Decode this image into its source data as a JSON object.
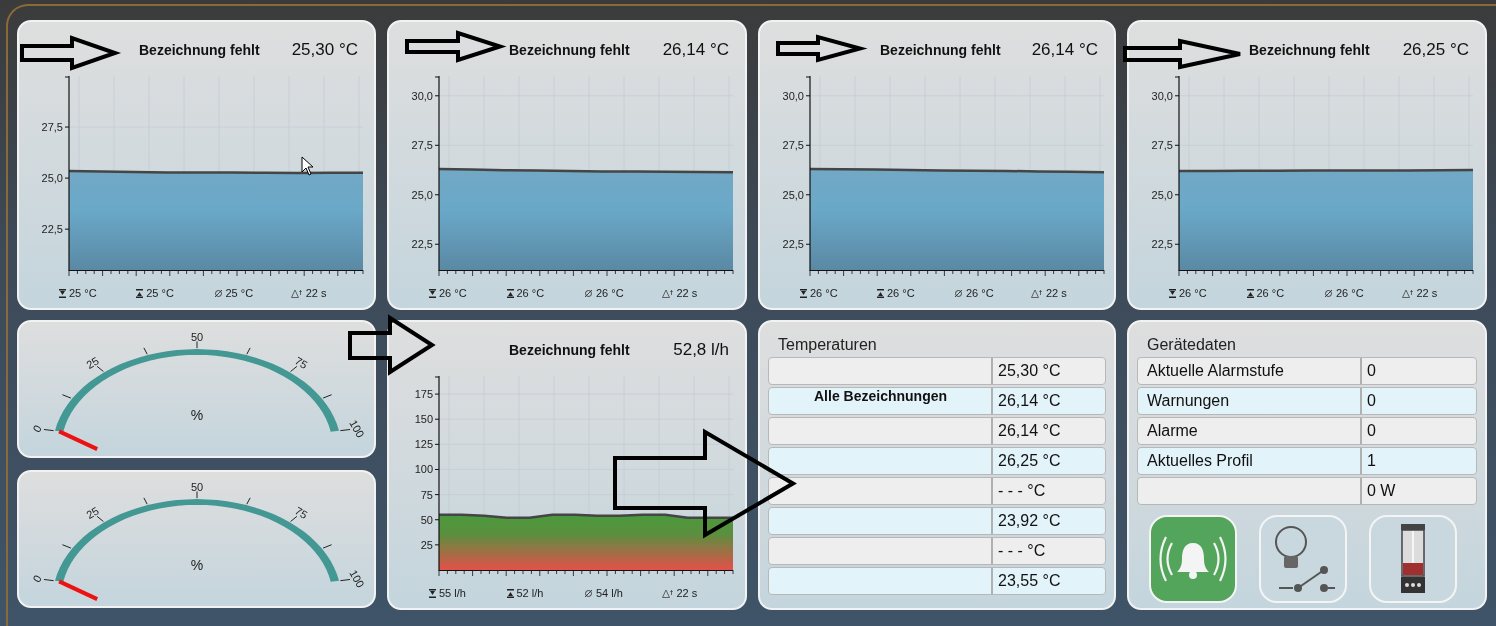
{
  "top_row": [
    {
      "title": "Bezeichnung fehlt",
      "reading": "25,30 °C",
      "chart_data": {
        "type": "area",
        "grid": true,
        "values": [
          25.35,
          25.33,
          25.3,
          25.28,
          25.27,
          25.27,
          25.26,
          25.25,
          25.26,
          25.26
        ],
        "ylim": [
          20.5,
          30
        ],
        "yticks": [
          {
            "value": 22.5,
            "label": "22,5"
          },
          {
            "value": 25,
            "label": "25,0"
          },
          {
            "value": 27.5,
            "label": "27,5"
          }
        ]
      },
      "stats": [
        {
          "kind": "max",
          "value": "25 °C"
        },
        {
          "kind": "min",
          "value": "25 °C"
        },
        {
          "kind": "average",
          "value": "25 °C"
        },
        {
          "kind": "span",
          "value": "22 s"
        }
      ]
    },
    {
      "title": "Bezeichnung fehlt",
      "reading": "26,14 °C",
      "chart_data": {
        "type": "area",
        "grid": true,
        "values": [
          26.3,
          26.28,
          26.24,
          26.22,
          26.2,
          26.18,
          26.17,
          26.16,
          26.15,
          26.14
        ],
        "ylim": [
          21.2,
          31
        ],
        "yticks": [
          {
            "value": 22.5,
            "label": "22,5"
          },
          {
            "value": 25,
            "label": "25,0"
          },
          {
            "value": 27.5,
            "label": "27,5"
          },
          {
            "value": 30,
            "label": "30,0"
          }
        ]
      },
      "stats": [
        {
          "kind": "max",
          "value": "26 °C"
        },
        {
          "kind": "min",
          "value": "26 °C"
        },
        {
          "kind": "average",
          "value": "26 °C"
        },
        {
          "kind": "span",
          "value": "22 s"
        }
      ]
    },
    {
      "title": "Bezeichnung fehlt",
      "reading": "26,14 °C",
      "chart_data": {
        "type": "area",
        "grid": true,
        "values": [
          26.3,
          26.29,
          26.27,
          26.25,
          26.23,
          26.21,
          26.2,
          26.18,
          26.16,
          26.14
        ],
        "ylim": [
          21.2,
          31
        ],
        "yticks": [
          {
            "value": 22.5,
            "label": "22,5"
          },
          {
            "value": 25,
            "label": "25,0"
          },
          {
            "value": 27.5,
            "label": "27,5"
          },
          {
            "value": 30,
            "label": "30,0"
          }
        ]
      },
      "stats": [
        {
          "kind": "max",
          "value": "26 °C"
        },
        {
          "kind": "min",
          "value": "26 °C"
        },
        {
          "kind": "average",
          "value": "26 °C"
        },
        {
          "kind": "span",
          "value": "22 s"
        }
      ]
    },
    {
      "title": "Bezeichnung fehlt",
      "reading": "26,25 °C",
      "chart_data": {
        "type": "area",
        "grid": true,
        "values": [
          26.2,
          26.2,
          26.21,
          26.21,
          26.22,
          26.22,
          26.23,
          26.23,
          26.24,
          26.25
        ],
        "ylim": [
          21.2,
          31
        ],
        "yticks": [
          {
            "value": 22.5,
            "label": "22,5"
          },
          {
            "value": 25,
            "label": "25,0"
          },
          {
            "value": 27.5,
            "label": "27,5"
          },
          {
            "value": 30,
            "label": "30,0"
          }
        ]
      },
      "stats": [
        {
          "kind": "max",
          "value": "26 °C"
        },
        {
          "kind": "min",
          "value": "26 °C"
        },
        {
          "kind": "average",
          "value": "26 °C"
        },
        {
          "kind": "span",
          "value": "22 s"
        }
      ]
    }
  ],
  "gauges": [
    {
      "ticks": [
        "0",
        "25",
        "50",
        "75",
        "100"
      ],
      "unit": "%"
    },
    {
      "ticks": [
        "0",
        "25",
        "50",
        "75",
        "100"
      ],
      "unit": "%"
    }
  ],
  "flow_chart": {
    "title": "Bezeichnung fehlt",
    "reading": "52,8 l/h",
    "chart_data": {
      "type": "area",
      "grid": true,
      "values": [
        55,
        55,
        54,
        52,
        52,
        55,
        55,
        54,
        54,
        55,
        55,
        52,
        52,
        52
      ],
      "ylim": [
        0,
        193
      ],
      "yticks": [
        {
          "value": 25,
          "label": "25"
        },
        {
          "value": 50,
          "label": "50"
        },
        {
          "value": 75,
          "label": "75"
        },
        {
          "value": 100,
          "label": "100"
        },
        {
          "value": 125,
          "label": "125"
        },
        {
          "value": 150,
          "label": "150"
        },
        {
          "value": 175,
          "label": "175"
        }
      ]
    },
    "stats": [
      {
        "kind": "max",
        "value": "55 l/h"
      },
      {
        "kind": "min",
        "value": "52 l/h"
      },
      {
        "kind": "average",
        "value": "54 l/h"
      },
      {
        "kind": "span",
        "value": "22 s"
      }
    ]
  },
  "temperatures": {
    "title": "Temperaturen",
    "note": "Alle Bezeichnungen",
    "rows": [
      {
        "value": "25,30 °C"
      },
      {
        "value": "26,14 °C"
      },
      {
        "value": "26,14 °C"
      },
      {
        "value": "26,25 °C"
      },
      {
        "value": "- - - °C"
      },
      {
        "value": "23,92 °C"
      },
      {
        "value": "- - - °C"
      },
      {
        "value": "23,55 °C"
      }
    ]
  },
  "device_data": {
    "title": "Gerätedaten",
    "rows": [
      {
        "label": "Aktuelle Alarmstufe",
        "value": "0"
      },
      {
        "label": "Warnungen",
        "value": "0"
      },
      {
        "label": "Alarme",
        "value": "0"
      },
      {
        "label": "Aktuelles Profil",
        "value": "1"
      },
      {
        "value": "0 W"
      }
    ],
    "buttons": [
      {
        "kind": "alarm",
        "on": true
      },
      {
        "kind": "light-switch",
        "on": false
      },
      {
        "kind": "tank",
        "on": false
      }
    ]
  }
}
